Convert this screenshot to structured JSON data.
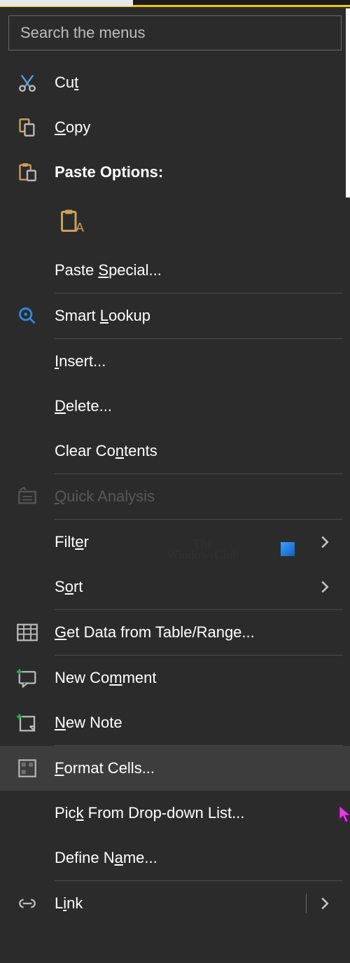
{
  "search": {
    "placeholder": "Search the menus"
  },
  "items": {
    "cut": {
      "pre": "Cu",
      "u": "t",
      "post": ""
    },
    "copy": {
      "pre": "",
      "u": "C",
      "post": "opy"
    },
    "paste_options": {
      "pre": "Paste Options:",
      "u": "",
      "post": ""
    },
    "paste_special": {
      "pre": "Paste ",
      "u": "S",
      "post": "pecial..."
    },
    "smart_lookup": {
      "pre": "Smart ",
      "u": "L",
      "post": "ookup"
    },
    "insert": {
      "pre": "",
      "u": "I",
      "post": "nsert..."
    },
    "delete": {
      "pre": "",
      "u": "D",
      "post": "elete..."
    },
    "clear": {
      "pre": "Clear Co",
      "u": "n",
      "post": "tents"
    },
    "quick_analysis": {
      "pre": "",
      "u": "Q",
      "post": "uick Analysis"
    },
    "filter": {
      "pre": "Filt",
      "u": "e",
      "post": "r"
    },
    "sort": {
      "pre": "S",
      "u": "o",
      "post": "rt"
    },
    "get_data": {
      "pre": "",
      "u": "G",
      "post": "et Data from Table/Range..."
    },
    "new_comment": {
      "pre": "New Co",
      "u": "m",
      "post": "ment"
    },
    "new_note": {
      "pre": "",
      "u": "N",
      "post": "ew Note"
    },
    "format_cells": {
      "pre": "",
      "u": "F",
      "post": "ormat Cells..."
    },
    "pick_list": {
      "pre": "Pic",
      "u": "k",
      "post": " From Drop-down List..."
    },
    "define_name": {
      "pre": "Define N",
      "u": "a",
      "post": "me..."
    },
    "link": {
      "pre": "L",
      "u": "i",
      "post": "nk"
    }
  },
  "watermark": {
    "line1": "The",
    "line2": "WindowsClub"
  }
}
